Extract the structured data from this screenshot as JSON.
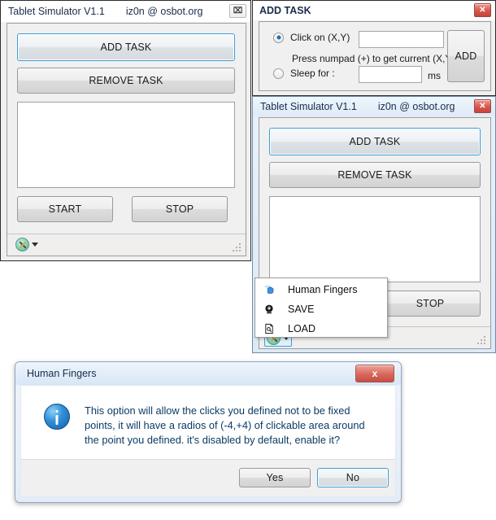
{
  "main_window": {
    "title": "Tablet Simulator V1.1",
    "subtitle": "iz0n @ osbot.org",
    "close_label": "⌧",
    "add_task_label": "ADD TASK",
    "remove_task_label": "REMOVE TASK",
    "start_label": "START",
    "stop_label": "STOP",
    "listbox_value": "",
    "tool_icon": "tools-icon",
    "dropdown_icon": "chevron-down-icon",
    "resize_grip": "resize-grip-icon"
  },
  "add_task_dialog": {
    "title": "ADD TASK",
    "close_label": "✕",
    "click_radio_label": "Click on (X,Y)",
    "click_radio_selected": true,
    "hint_label": "Press numpad (+) to get current (X,Y)",
    "sleep_radio_label": "Sleep for :",
    "sleep_radio_selected": false,
    "coord_value": "",
    "coord_placeholder": "",
    "sleep_value": "",
    "sleep_placeholder": "",
    "ms_label": "ms",
    "add_button_label": "ADD"
  },
  "second_window": {
    "title": "Tablet Simulator V1.1",
    "subtitle": "iz0n @ osbot.org",
    "close_label": "✕",
    "add_task_label": "ADD TASK",
    "remove_task_label": "REMOVE TASK",
    "stop_label": "STOP",
    "listbox_value": "",
    "tool_icon": "tools-icon",
    "dropdown_icon": "chevron-down-icon",
    "resize_grip": "resize-grip-icon"
  },
  "context_menu": {
    "items": [
      {
        "label": "Human Fingers",
        "icon": "hand-pointer-icon"
      },
      {
        "label": "SAVE",
        "icon": "save-download-icon"
      },
      {
        "label": "LOAD",
        "icon": "document-search-icon"
      }
    ]
  },
  "message_box": {
    "title": "Human Fingers",
    "close_label": "x",
    "icon": "info-icon",
    "message": "This option will allow the clicks you defined not to be fixed points, it will have a radios of (-4,+4) of clickable area around the point you defined. it's disabled by default, enable it?",
    "yes_label": "Yes",
    "no_label": "No",
    "default_button": "No"
  },
  "colors": {
    "accent_focus": "#3c9fd6",
    "close_red": "#d8564c",
    "title_text": "#1b2c4b",
    "message_text": "#0b3b66",
    "window_bg": "#f0f0f0"
  }
}
